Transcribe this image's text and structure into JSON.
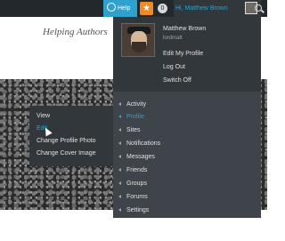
{
  "adminbar": {
    "help_label": "Help",
    "notification_count": "0",
    "howdy": "Hi, Matthew Brown",
    "star_icon": "star-icon",
    "search_icon": "search-icon"
  },
  "site": {
    "tagline": "Helping Authors"
  },
  "profile_menu": {
    "items": [
      {
        "label": "View"
      },
      {
        "label": "Edit"
      },
      {
        "label": "Change Profile Photo"
      },
      {
        "label": "Change Cover Image"
      }
    ]
  },
  "account": {
    "name": "Matthew Brown",
    "username": "lordmatt",
    "edit_profile": "Edit My Profile",
    "log_out": "Log Out",
    "switch_off": "Switch Off"
  },
  "submenu": {
    "items": [
      {
        "label": "Activity"
      },
      {
        "label": "Profile"
      },
      {
        "label": "Sites"
      },
      {
        "label": "Notifications"
      },
      {
        "label": "Messages"
      },
      {
        "label": "Friends"
      },
      {
        "label": "Groups"
      },
      {
        "label": "Forums"
      },
      {
        "label": "Settings"
      }
    ],
    "active_item": "Profile"
  },
  "colors": {
    "adminbar_bg": "#23282d",
    "accent": "#2ea2cc",
    "star": "#f08a24",
    "menu_bg": "#32373c",
    "submenu_bg": "#3e4449"
  }
}
